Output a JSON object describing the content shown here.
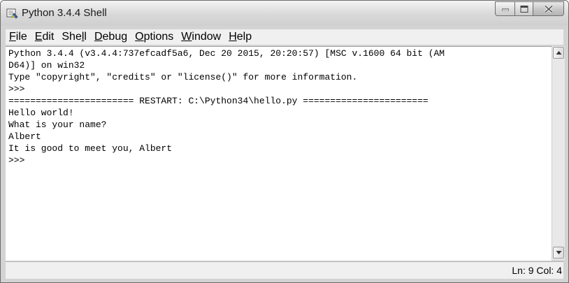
{
  "window": {
    "title": "Python 3.4.4 Shell"
  },
  "menu": [
    {
      "pre": "",
      "u": "F",
      "post": "ile"
    },
    {
      "pre": "",
      "u": "E",
      "post": "dit"
    },
    {
      "pre": "She",
      "u": "l",
      "post": "l"
    },
    {
      "pre": "",
      "u": "D",
      "post": "ebug"
    },
    {
      "pre": "",
      "u": "O",
      "post": "ptions"
    },
    {
      "pre": "",
      "u": "W",
      "post": "indow"
    },
    {
      "pre": "",
      "u": "H",
      "post": "elp"
    }
  ],
  "shell": {
    "lines": [
      "Python 3.4.4 (v3.4.4:737efcadf5a6, Dec 20 2015, 20:20:57) [MSC v.1600 64 bit (AM",
      "D64)] on win32",
      "Type \"copyright\", \"credits\" or \"license()\" for more information.",
      ">>> ",
      "======================= RESTART: C:\\Python34\\hello.py =======================",
      "Hello world!",
      "What is your name?",
      "Albert",
      "It is good to meet you, Albert",
      ">>> "
    ]
  },
  "status": {
    "position": "Ln: 9  Col: 4"
  },
  "icons": {
    "app": "python-shell-icon",
    "minimize": "minimize-icon",
    "maximize": "maximize-icon",
    "close": "close-icon"
  }
}
